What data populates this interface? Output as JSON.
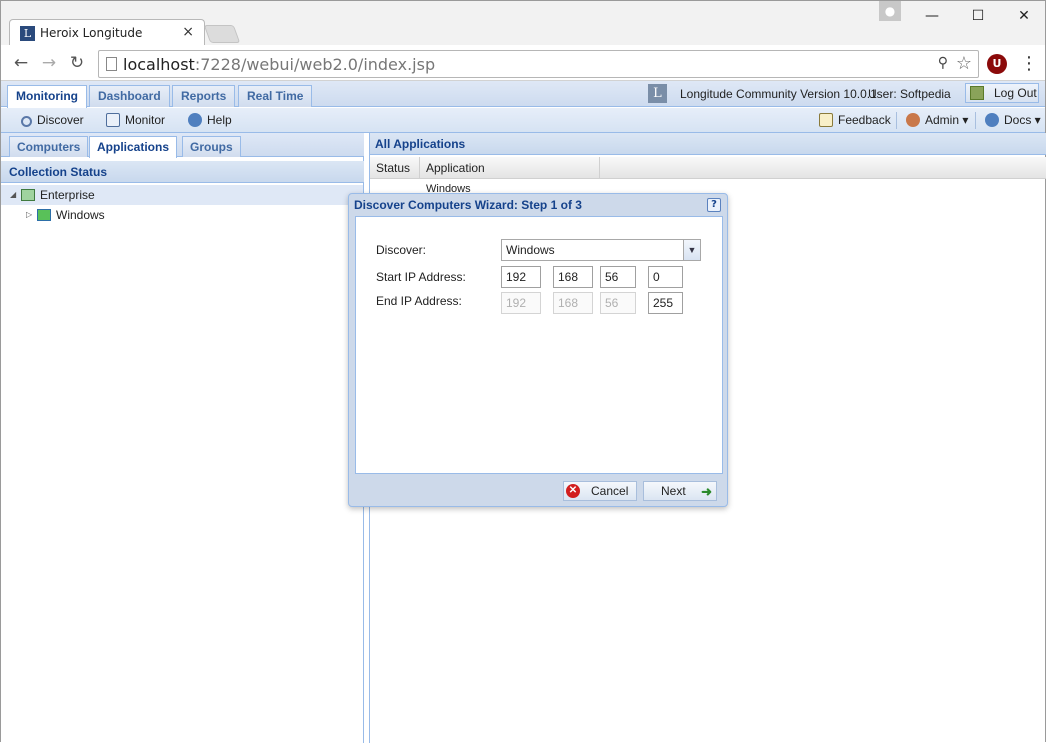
{
  "browser": {
    "tab_title": "Heroix Longitude",
    "tab_close": "×",
    "url_host": "localhost",
    "url_rest": ":7228/webui/web2.0/index.jsp",
    "win_minimize": "—",
    "win_maximize": "☐",
    "win_close": "✕",
    "profile_icon": "profile-icon",
    "ublock_label": "U"
  },
  "app": {
    "nav_tabs": [
      {
        "label": "Monitoring"
      },
      {
        "label": "Dashboard"
      },
      {
        "label": "Reports"
      },
      {
        "label": "Real Time"
      }
    ],
    "version_text": "Longitude Community Version 10.0.1",
    "user_text": "User: Softpedia",
    "logout_label": "Log Out",
    "toolbar": {
      "discover": "Discover",
      "monitor": "Monitor",
      "help": "Help",
      "feedback": "Feedback",
      "admin": "Admin ▾",
      "docs": "Docs ▾"
    }
  },
  "left_panel": {
    "tabs": [
      {
        "label": "Computers"
      },
      {
        "label": "Applications"
      },
      {
        "label": "Groups"
      }
    ],
    "header": "Collection Status",
    "tree": [
      {
        "label": "Enterprise"
      },
      {
        "label": "Windows"
      }
    ]
  },
  "right_panel": {
    "header": "All Applications",
    "columns": [
      "Status",
      "Application"
    ],
    "rows": [
      {
        "application": "Windows"
      }
    ]
  },
  "dialog": {
    "title": "Discover Computers Wizard: Step 1 of 3",
    "help": "?",
    "discover_label": "Discover:",
    "discover_value": "Windows",
    "start_ip_label": "Start IP Address:",
    "end_ip_label": "End IP Address:",
    "start_ip": [
      "192",
      "168",
      "56",
      "0"
    ],
    "end_ip": [
      "192",
      "168",
      "56",
      "255"
    ],
    "cancel_label": "Cancel",
    "next_label": "Next"
  },
  "colors": {
    "accent": "#15428b",
    "panel_border": "#99bbe8",
    "header_bg": "#dfe8f6"
  }
}
